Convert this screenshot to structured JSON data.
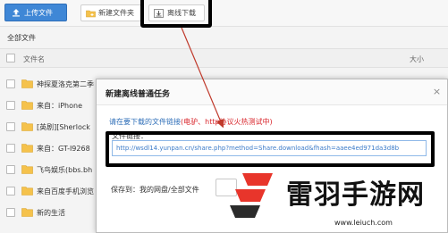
{
  "toolbar": {
    "upload_label": "上传文件",
    "newfolder_label": "新建文件夹",
    "offline_label": "离线下载"
  },
  "breadcrumb": "全部文件",
  "columns": {
    "name": "文件名",
    "size": "大小"
  },
  "files": [
    {
      "name": "神探夏洛克第二季"
    },
    {
      "name": "来自：iPhone"
    },
    {
      "name": "[英剧][Sherlock"
    },
    {
      "name": "来自：GT-I9268"
    },
    {
      "name": "飞鸟娱乐(bbs.bh"
    },
    {
      "name": "来自百度手机浏览"
    },
    {
      "name": "新的生活"
    }
  ],
  "dialog": {
    "title": "新建离线普通任务",
    "close": "×",
    "hint_prefix": "请在要下载的文件链接",
    "hint_red": "(电驴、http协议火热测试中)",
    "link_label": "文件链接：",
    "url": "http://wsdl14.yunpan.cn/share.php?method=Share.download&fhash=aaee4ed971da3d8b",
    "save_label": "保存到：",
    "save_path": "我的网盘/全部文件"
  },
  "watermark": {
    "name": "雷羽手游网",
    "url": "www.leiuch.com"
  },
  "colors": {
    "upload_blue": "#3f87d6",
    "link_blue": "#3d7cc9",
    "hint_red": "#d9262c",
    "arrow_red": "#c0392b",
    "logo_red": "#e8352b"
  }
}
